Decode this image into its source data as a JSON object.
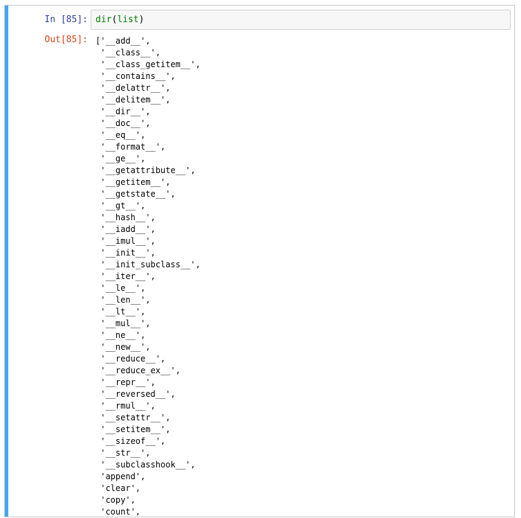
{
  "cell": {
    "in_prompt": "In [85]:",
    "out_prompt": "Out[85]:",
    "input": {
      "func": "dir",
      "open_paren": "(",
      "arg": "list",
      "close_paren": ")"
    },
    "output_lines": [
      "['__add__',",
      " '__class__',",
      " '__class_getitem__',",
      " '__contains__',",
      " '__delattr__',",
      " '__delitem__',",
      " '__dir__',",
      " '__doc__',",
      " '__eq__',",
      " '__format__',",
      " '__ge__',",
      " '__getattribute__',",
      " '__getitem__',",
      " '__getstate__',",
      " '__gt__',",
      " '__hash__',",
      " '__iadd__',",
      " '__imul__',",
      " '__init__',",
      " '__init_subclass__',",
      " '__iter__',",
      " '__le__',",
      " '__len__',",
      " '__lt__',",
      " '__mul__',",
      " '__ne__',",
      " '__new__',",
      " '__reduce__',",
      " '__reduce_ex__',",
      " '__repr__',",
      " '__reversed__',",
      " '__rmul__',",
      " '__setattr__',",
      " '__setitem__',",
      " '__sizeof__',",
      " '__str__',",
      " '__subclasshook__',",
      " 'append',",
      " 'clear',",
      " 'copy',",
      " 'count',"
    ]
  },
  "colors": {
    "cell_selected_bar": "#42a5f5",
    "in_prompt": "#303f9f",
    "out_prompt": "#d84315",
    "builtin": "#008000",
    "input_bg": "#f7f7f7"
  }
}
